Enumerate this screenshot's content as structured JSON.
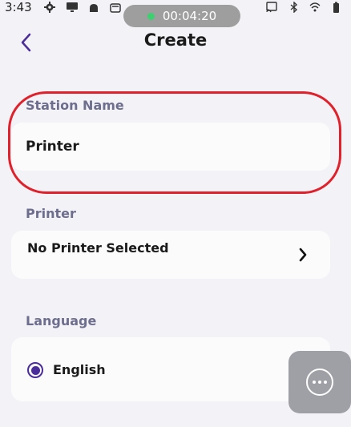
{
  "status_bar": {
    "time": "3:43",
    "left_icons": [
      "gear-icon",
      "monitor-icon",
      "android-icon",
      "store-icon"
    ],
    "right_icons": [
      "cast-icon",
      "bluetooth-icon",
      "wifi-icon",
      "battery-icon"
    ]
  },
  "recording": {
    "timer": "00:04:20",
    "dot_color": "#3CD070"
  },
  "header": {
    "title": "Create"
  },
  "station_name": {
    "label": "Station Name",
    "value": "Printer"
  },
  "printer": {
    "label": "Printer",
    "value": "No Printer Selected"
  },
  "language": {
    "label": "Language",
    "selected": "English"
  },
  "colors": {
    "accent": "#4A2C9A",
    "highlight": "#E0202A",
    "label": "#6D6E8E",
    "background": "#F3F2F7"
  }
}
